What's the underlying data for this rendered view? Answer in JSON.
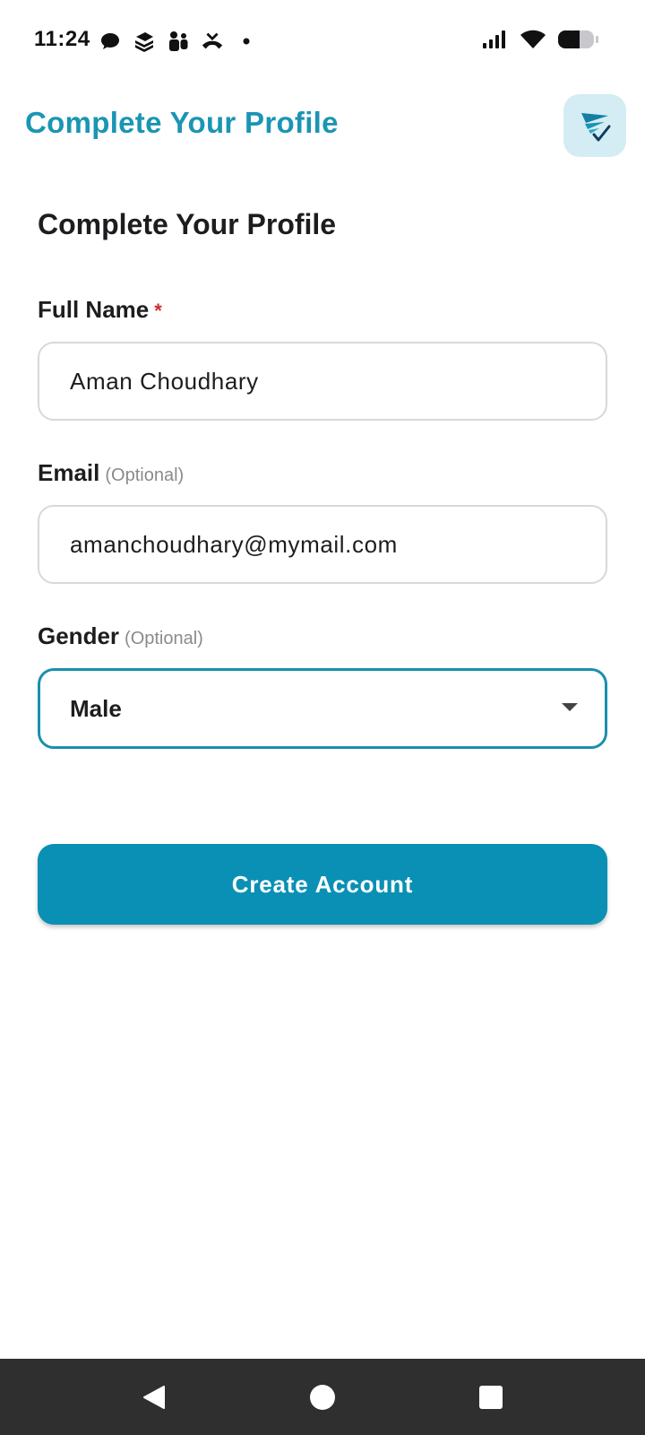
{
  "status_bar": {
    "time": "11:24",
    "left_icons": [
      "chat-bubble-icon",
      "layers-icon",
      "teams-icon",
      "missed-call-icon",
      "dot-icon"
    ],
    "right_icons": [
      "signal-icon",
      "wifi-icon",
      "battery-icon"
    ]
  },
  "header": {
    "title": "Complete Your Profile",
    "logo_icon": "app-logo-icon"
  },
  "form": {
    "heading": "Complete Your Profile",
    "full_name": {
      "label": "Full Name",
      "required_marker": "*",
      "value": "Aman Choudhary"
    },
    "email": {
      "label": "Email",
      "optional_text": "(Optional)",
      "value": "amanchoudhary@mymail.com"
    },
    "gender": {
      "label": "Gender",
      "optional_text": "(Optional)",
      "selected": "Male"
    },
    "submit_label": "Create Account"
  },
  "nav_bar": {
    "buttons": [
      "back-icon",
      "home-icon",
      "recents-icon"
    ]
  },
  "colors": {
    "accent": "#1b95b3",
    "button": "#0a90b4",
    "required": "#cc2b2b",
    "nav_bar": "#2f2f2f"
  }
}
